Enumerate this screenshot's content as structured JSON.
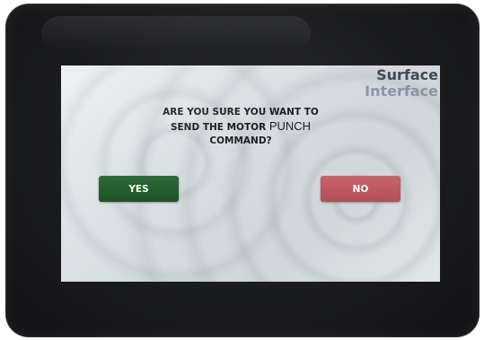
{
  "brand": {
    "line1": "Surface",
    "line2": "Interface"
  },
  "dialog": {
    "line1": "ARE YOU SURE YOU WANT TO",
    "line2_prefix": "SEND THE MOTOR",
    "command": "PUNCH",
    "line3": "COMMAND?"
  },
  "buttons": {
    "yes_label": "YES",
    "no_label": "NO"
  },
  "colors": {
    "yes": "#1f5a2b",
    "no": "#c0585f",
    "brand_dark": "#3f4a57",
    "brand_light": "#8a96a2"
  }
}
